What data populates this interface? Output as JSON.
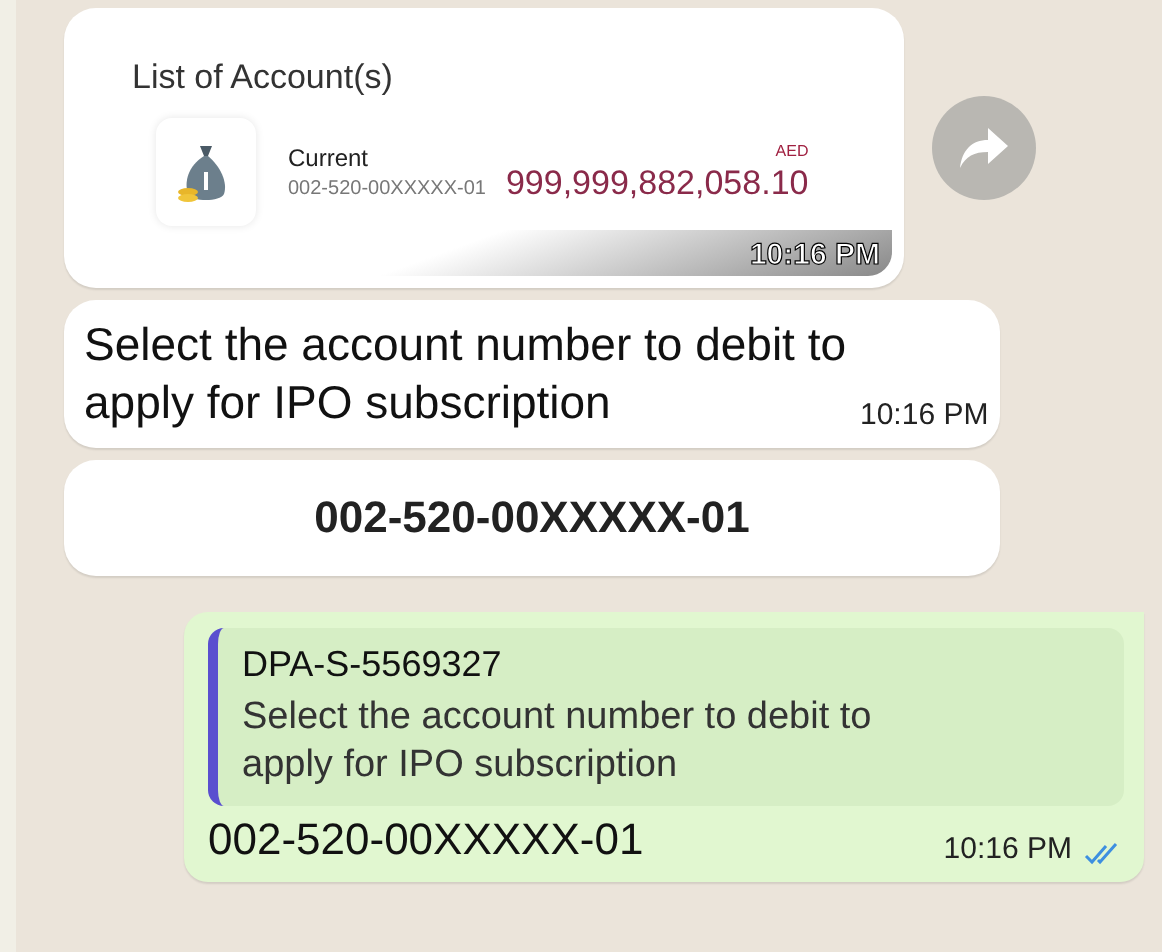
{
  "messages": [
    {
      "kind": "card",
      "title": "List of Account(s)",
      "account": {
        "type": "Current",
        "number": "002-520-00XXXXX-01",
        "currency": "AED",
        "balance": "999,999,882,058.10"
      },
      "time": "10:16 PM"
    },
    {
      "kind": "text",
      "text": "Select the account number to debit to apply for IPO subscription",
      "time": "10:16 PM"
    },
    {
      "kind": "reply-button",
      "label": "002-520-00XXXXX-01"
    },
    {
      "kind": "sent",
      "quote": {
        "author": "DPA-S-5569327",
        "text": "Select the account number to debit to apply for IPO subscription"
      },
      "text": "002-520-00XXXXX-01",
      "time": "10:16 PM",
      "read": true
    }
  ]
}
